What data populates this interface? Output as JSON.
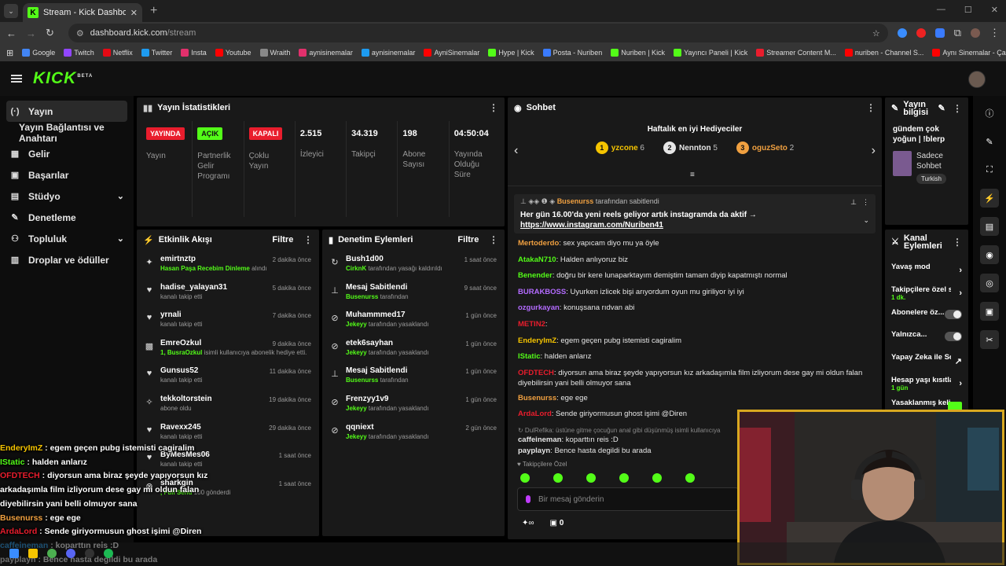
{
  "browser": {
    "tab_title": "Stream - Kick Dashboard",
    "url_host": "dashboard.kick.com",
    "url_path": "/stream",
    "bookmarks": [
      "Google",
      "Twitch",
      "Netflix",
      "Twitter",
      "Insta",
      "Youtube",
      "Wraith",
      "aynisinemalar",
      "aynisinemalar",
      "AyniSinemalar",
      "Hype | Kick",
      "Posta - Nuriben",
      "Nuriben | Kick",
      "Yayıncı Paneli | Kick",
      "Streamer Content M...",
      "nuriben - Channel S...",
      "Aynı Sinemalar - Ça..."
    ],
    "bookmark_colors": [
      "#4285f4",
      "#9146ff",
      "#e50914",
      "#1d9bf0",
      "#e1306c",
      "#ff0000",
      "#888888",
      "#e1306c",
      "#1d9bf0",
      "#ff0000",
      "#53fc18",
      "#3a7bff",
      "#53fc18",
      "#53fc18",
      "#e91d2d",
      "#ff0000",
      "#ff0000"
    ]
  },
  "header": {
    "logo": "KICK",
    "logo_badge": "BETA"
  },
  "sidebar": {
    "items": [
      {
        "label": "Yayın",
        "icon": "broadcast-icon",
        "glyph": "(·)"
      },
      {
        "label": "Yayın Bağlantısı ve Anahtarı",
        "sub": true
      },
      {
        "label": "Gelir",
        "icon": "revenue-icon",
        "glyph": "▦"
      },
      {
        "label": "Başarılar",
        "icon": "achievements-icon",
        "glyph": "▣"
      },
      {
        "label": "Stüdyo",
        "icon": "studio-icon",
        "glyph": "▤",
        "chevron": true
      },
      {
        "label": "Denetleme",
        "icon": "moderation-icon",
        "glyph": "✎"
      },
      {
        "label": "Topluluk",
        "icon": "community-icon",
        "glyph": "⚇",
        "chevron": true
      },
      {
        "label": "Droplar ve ödüller",
        "icon": "drops-icon",
        "glyph": "▥"
      }
    ]
  },
  "stats": {
    "title": "Yayın İstatistikleri",
    "cols": [
      {
        "badge": "YAYINDA",
        "badge_color": "#e91d2d",
        "label": "Yayın"
      },
      {
        "badge": "AÇIK",
        "badge_color": "#53fc18",
        "label": "Partnerlik Gelir Programı"
      },
      {
        "badge": "KAPALI",
        "badge_color": "#e91d2d",
        "label": "Çoklu Yayın"
      },
      {
        "value": "2.515",
        "label": "İzleyici"
      },
      {
        "value": "34.319",
        "label": "Takipçi"
      },
      {
        "value": "198",
        "label": "Abone Sayısı"
      },
      {
        "value": "04:50:04",
        "label": "Yayında Olduğu Süre"
      }
    ]
  },
  "activity": {
    "title": "Etkinlik Akışı",
    "filter": "Filtre",
    "items": [
      {
        "icon": "gift-sub-icon",
        "glyph": "✦",
        "name": "emirtnztp",
        "time": "2 dakika önce",
        "hl": "Hasan Paşa Recebim Dinleme",
        "sub": " alındı"
      },
      {
        "icon": "heart-icon",
        "glyph": "♥",
        "name": "hadise_yalayan31",
        "time": "5 dakika önce",
        "sub": "kanalı takip etti"
      },
      {
        "icon": "heart-icon",
        "glyph": "♥",
        "name": "yrnali",
        "time": "7 dakika önce",
        "sub": "kanalı takip etti"
      },
      {
        "icon": "gift-icon",
        "glyph": "▩",
        "name": "EmreOzkul",
        "time": "9 dakika önce",
        "hl": "1, BusraOzkul",
        "sub": " isimli kullanıcıya abonelik hediye etti."
      },
      {
        "icon": "heart-icon",
        "glyph": "♥",
        "name": "Gunsus52",
        "time": "11 dakika önce",
        "sub": "kanalı takip etti"
      },
      {
        "icon": "star-icon",
        "glyph": "✧",
        "name": "tekkoltorstein",
        "time": "19 dakika önce",
        "sub": "abone oldu"
      },
      {
        "icon": "heart-icon",
        "glyph": "♥",
        "name": "Ravexx245",
        "time": "29 dakika önce",
        "sub": "kanalı takip etti"
      },
      {
        "icon": "heart-icon",
        "glyph": "♥",
        "name": "ByMesMes06",
        "time": "1 saat önce",
        "sub": "kanalı takip etti"
      },
      {
        "icon": "kicks-icon",
        "glyph": "⊗",
        "name": "sharkgin",
        "time": "1 saat önce",
        "hl": ", Full Send",
        "sub": " 100 gönderdi"
      }
    ]
  },
  "modlog": {
    "title": "Denetim Eylemleri",
    "filter": "Filtre",
    "items": [
      {
        "icon": "unban-icon",
        "glyph": "↻",
        "name": "Bush1d00",
        "time": "1 saat önce",
        "hl": "CirknK",
        "sub": " tarafından yasağı kaldırıldı"
      },
      {
        "icon": "pin-icon",
        "glyph": "⊥",
        "name": "Mesaj Sabitlendi",
        "time": "9 saat önce",
        "hl": "Busenurss",
        "sub": " tarafından"
      },
      {
        "icon": "ban-icon",
        "glyph": "⊘",
        "name": "Muhammmed17",
        "time": "1 gün önce",
        "hl": "Jekeyy",
        "sub": " tarafından yasaklandı"
      },
      {
        "icon": "ban-icon",
        "glyph": "⊘",
        "name": "etek6sayhan",
        "time": "1 gün önce",
        "hl": "Jekeyy",
        "sub": " tarafından yasaklandı"
      },
      {
        "icon": "pin-icon",
        "glyph": "⊥",
        "name": "Mesaj Sabitlendi",
        "time": "1 gün önce",
        "hl": "Busenurss",
        "sub": " tarafından"
      },
      {
        "icon": "ban-icon",
        "glyph": "⊘",
        "name": "Frenzyy1v9",
        "time": "1 gün önce",
        "hl": "Jekeyy",
        "sub": " tarafından yasaklandı"
      },
      {
        "icon": "ban-icon",
        "glyph": "⊘",
        "name": "qqniext",
        "time": "2 gün önce",
        "hl": "Jekeyy",
        "sub": " tarafından yasaklandı"
      }
    ]
  },
  "chat": {
    "title": "Sohbet",
    "gifters_title": "Haftalık en iyi Hediyeciler",
    "gifters": [
      {
        "rank": "1",
        "name": "yzcone",
        "count": "6",
        "color": "#f5c400"
      },
      {
        "rank": "2",
        "name": "Nennton",
        "count": "5",
        "color": "#e6e6e6"
      },
      {
        "rank": "3",
        "name": "oguzSeto",
        "count": "2",
        "color": "#f0a040"
      }
    ],
    "pinned_by": "Busenurss",
    "pinned_suffix": " tarafından sabitlendi",
    "pinned_text": "Her gün 16.00'da yeni reels geliyor artık instagramda da aktif →",
    "pinned_link": "https://www.instagram.com/Nuriben41",
    "messages": [
      {
        "user": "Mertoderdo",
        "color": "#f0a040",
        "text": ": sex yapıcam diyo mu ya öyle"
      },
      {
        "user": "AtakaN710",
        "color": "#53fc18",
        "text": ": Halden anlıyoruz biz"
      },
      {
        "user": "Benender",
        "color": "#53fc18",
        "text": ": doğru bir kere lunaparktayım demiştim tamam diyip kapatmıştı normal"
      },
      {
        "user": "BURAKBOSS",
        "color": "#b36bff",
        "text": ": Uyurken izlicek bişi arıyordum oyun mu giriliyor iyi iyi"
      },
      {
        "user": "ozgurkayan",
        "color": "#b36bff",
        "text": ": konuşsana rıdvan abi"
      },
      {
        "user": "METIN2",
        "color": "#e91d2d",
        "text": ":"
      },
      {
        "user": "EnderyImZ",
        "color": "#f5c400",
        "text": ": egem geçen pubg istemisti cagiralim"
      },
      {
        "user": "IStatic",
        "color": "#53fc18",
        "text": ": halden anlarız"
      },
      {
        "user": "OFDTECH",
        "color": "#e91d2d",
        "text": ": diyorsun ama biraz şeyde yapıyorsun kız arkadaşımla film izliyorum dese gay mi oldun falan diyebilirsin yani belli olmuyor sana"
      },
      {
        "user": "Busenurss",
        "color": "#f0a040",
        "text": ": ege ege"
      },
      {
        "user": "ArdaLord",
        "color": "#e91d2d",
        "text": ": Sende giriyormusun ghost işimi @Diren"
      },
      {
        "user": "caffeineman",
        "color": "#e6e6e6",
        "text": ": koparttın reis :D",
        "reply": "↻ DulRefika: üstüne gitme çocuğun anal gibi düşünmüş isimli kullanıcıya"
      },
      {
        "user": "payplayn",
        "color": "#e6e6e6",
        "text": ": Bence hasta degildi bu arada"
      }
    ],
    "followers_only": "Takipçilere Özel",
    "input_placeholder": "Bir mesaj gönderin",
    "kicks_count": "0"
  },
  "stream_info": {
    "title": "Yayın bilgisi",
    "stream_title": "gündem çok yoğun | !blerp",
    "category": "Sadece Sohbet",
    "language": "Turkish"
  },
  "chat_actions": {
    "title": "Kanal Eylemleri",
    "items": [
      {
        "label": "Yavaş mod",
        "kind": "arrow"
      },
      {
        "label": "Takipçilere özel s",
        "sub": "1 dk.",
        "kind": "arrow"
      },
      {
        "label": "Abonelere öz...",
        "kind": "toggle"
      },
      {
        "label": "Yalnızca...",
        "kind": "toggle"
      },
      {
        "label": "Yapay Zeka ile Sohbet Denetimi",
        "kind": "ext"
      },
      {
        "label": "Hesap yaşı kısıtla",
        "sub": "1 gün",
        "kind": "arrow"
      },
      {
        "label": "Yasaklanmış kelim",
        "kind": "green"
      }
    ]
  },
  "overlay": {
    "lines": [
      {
        "user": "EnderyImZ",
        "color": "#f5c400",
        "text": " : egem geçen pubg istemisti cagiralim"
      },
      {
        "user": "IStatic",
        "color": "#53fc18",
        "text": " : halden anlarız"
      },
      {
        "user": "OFDTECH",
        "color": "#e91d2d",
        "text": " : diyorsun ama biraz şeyde yapıyorsun kız"
      },
      {
        "user": "",
        "color": "#fff",
        "text": "arkadaşımla film izliyorum dese gay mi oldun falan"
      },
      {
        "user": "",
        "color": "#fff",
        "text": "diyebilirsin yani belli olmuyor sana"
      },
      {
        "user": "Busenurss",
        "color": "#f0a040",
        "text": " : ege ege"
      },
      {
        "user": "ArdaLord",
        "color": "#e91d2d",
        "text": " : Sende giriyormusun ghost işimi @Diren"
      },
      {
        "user": "caffeineman",
        "color": "#1d9bf0",
        "text": " : koparttın reis :D"
      },
      {
        "user": "payplayn",
        "color": "#e6e6e6",
        "text": " : Bence hasta degildi bu arada"
      }
    ]
  },
  "colors": {
    "accent": "#53fc18",
    "live": "#e91d2d",
    "cam_border": "#d8a820"
  }
}
